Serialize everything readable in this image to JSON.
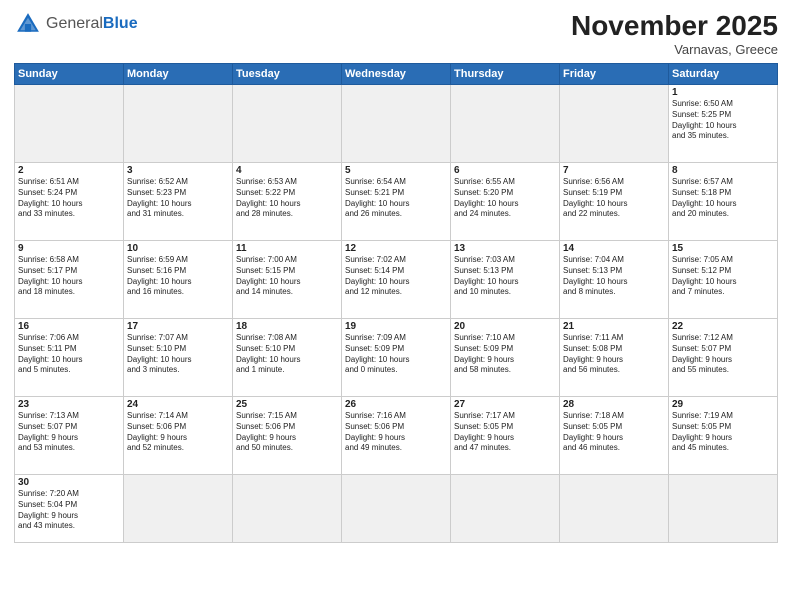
{
  "header": {
    "logo_general": "General",
    "logo_blue": "Blue",
    "month_title": "November 2025",
    "subtitle": "Varnavas, Greece"
  },
  "weekdays": [
    "Sunday",
    "Monday",
    "Tuesday",
    "Wednesday",
    "Thursday",
    "Friday",
    "Saturday"
  ],
  "weeks": [
    [
      {
        "day": "",
        "info": ""
      },
      {
        "day": "",
        "info": ""
      },
      {
        "day": "",
        "info": ""
      },
      {
        "day": "",
        "info": ""
      },
      {
        "day": "",
        "info": ""
      },
      {
        "day": "",
        "info": ""
      },
      {
        "day": "1",
        "info": "Sunrise: 6:50 AM\nSunset: 5:25 PM\nDaylight: 10 hours\nand 35 minutes."
      }
    ],
    [
      {
        "day": "2",
        "info": "Sunrise: 6:51 AM\nSunset: 5:24 PM\nDaylight: 10 hours\nand 33 minutes."
      },
      {
        "day": "3",
        "info": "Sunrise: 6:52 AM\nSunset: 5:23 PM\nDaylight: 10 hours\nand 31 minutes."
      },
      {
        "day": "4",
        "info": "Sunrise: 6:53 AM\nSunset: 5:22 PM\nDaylight: 10 hours\nand 28 minutes."
      },
      {
        "day": "5",
        "info": "Sunrise: 6:54 AM\nSunset: 5:21 PM\nDaylight: 10 hours\nand 26 minutes."
      },
      {
        "day": "6",
        "info": "Sunrise: 6:55 AM\nSunset: 5:20 PM\nDaylight: 10 hours\nand 24 minutes."
      },
      {
        "day": "7",
        "info": "Sunrise: 6:56 AM\nSunset: 5:19 PM\nDaylight: 10 hours\nand 22 minutes."
      },
      {
        "day": "8",
        "info": "Sunrise: 6:57 AM\nSunset: 5:18 PM\nDaylight: 10 hours\nand 20 minutes."
      }
    ],
    [
      {
        "day": "9",
        "info": "Sunrise: 6:58 AM\nSunset: 5:17 PM\nDaylight: 10 hours\nand 18 minutes."
      },
      {
        "day": "10",
        "info": "Sunrise: 6:59 AM\nSunset: 5:16 PM\nDaylight: 10 hours\nand 16 minutes."
      },
      {
        "day": "11",
        "info": "Sunrise: 7:00 AM\nSunset: 5:15 PM\nDaylight: 10 hours\nand 14 minutes."
      },
      {
        "day": "12",
        "info": "Sunrise: 7:02 AM\nSunset: 5:14 PM\nDaylight: 10 hours\nand 12 minutes."
      },
      {
        "day": "13",
        "info": "Sunrise: 7:03 AM\nSunset: 5:13 PM\nDaylight: 10 hours\nand 10 minutes."
      },
      {
        "day": "14",
        "info": "Sunrise: 7:04 AM\nSunset: 5:13 PM\nDaylight: 10 hours\nand 8 minutes."
      },
      {
        "day": "15",
        "info": "Sunrise: 7:05 AM\nSunset: 5:12 PM\nDaylight: 10 hours\nand 7 minutes."
      }
    ],
    [
      {
        "day": "16",
        "info": "Sunrise: 7:06 AM\nSunset: 5:11 PM\nDaylight: 10 hours\nand 5 minutes."
      },
      {
        "day": "17",
        "info": "Sunrise: 7:07 AM\nSunset: 5:10 PM\nDaylight: 10 hours\nand 3 minutes."
      },
      {
        "day": "18",
        "info": "Sunrise: 7:08 AM\nSunset: 5:10 PM\nDaylight: 10 hours\nand 1 minute."
      },
      {
        "day": "19",
        "info": "Sunrise: 7:09 AM\nSunset: 5:09 PM\nDaylight: 10 hours\nand 0 minutes."
      },
      {
        "day": "20",
        "info": "Sunrise: 7:10 AM\nSunset: 5:09 PM\nDaylight: 9 hours\nand 58 minutes."
      },
      {
        "day": "21",
        "info": "Sunrise: 7:11 AM\nSunset: 5:08 PM\nDaylight: 9 hours\nand 56 minutes."
      },
      {
        "day": "22",
        "info": "Sunrise: 7:12 AM\nSunset: 5:07 PM\nDaylight: 9 hours\nand 55 minutes."
      }
    ],
    [
      {
        "day": "23",
        "info": "Sunrise: 7:13 AM\nSunset: 5:07 PM\nDaylight: 9 hours\nand 53 minutes."
      },
      {
        "day": "24",
        "info": "Sunrise: 7:14 AM\nSunset: 5:06 PM\nDaylight: 9 hours\nand 52 minutes."
      },
      {
        "day": "25",
        "info": "Sunrise: 7:15 AM\nSunset: 5:06 PM\nDaylight: 9 hours\nand 50 minutes."
      },
      {
        "day": "26",
        "info": "Sunrise: 7:16 AM\nSunset: 5:06 PM\nDaylight: 9 hours\nand 49 minutes."
      },
      {
        "day": "27",
        "info": "Sunrise: 7:17 AM\nSunset: 5:05 PM\nDaylight: 9 hours\nand 47 minutes."
      },
      {
        "day": "28",
        "info": "Sunrise: 7:18 AM\nSunset: 5:05 PM\nDaylight: 9 hours\nand 46 minutes."
      },
      {
        "day": "29",
        "info": "Sunrise: 7:19 AM\nSunset: 5:05 PM\nDaylight: 9 hours\nand 45 minutes."
      }
    ],
    [
      {
        "day": "30",
        "info": "Sunrise: 7:20 AM\nSunset: 5:04 PM\nDaylight: 9 hours\nand 43 minutes."
      },
      {
        "day": "",
        "info": ""
      },
      {
        "day": "",
        "info": ""
      },
      {
        "day": "",
        "info": ""
      },
      {
        "day": "",
        "info": ""
      },
      {
        "day": "",
        "info": ""
      },
      {
        "day": "",
        "info": ""
      }
    ]
  ]
}
